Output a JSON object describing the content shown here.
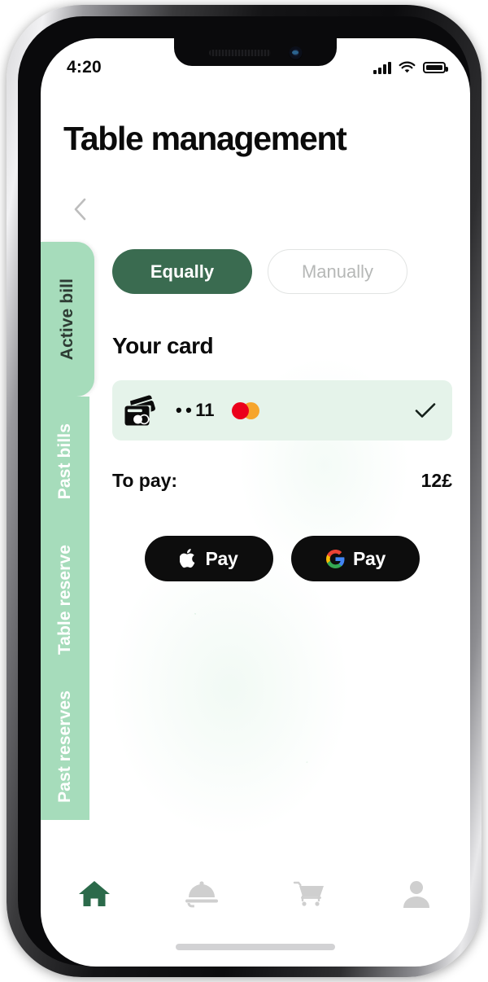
{
  "status_bar": {
    "time": "4:20",
    "signal_icon": "cellular-signal-icon",
    "wifi_icon": "wifi-icon",
    "battery_icon": "battery-full-icon"
  },
  "header": {
    "title": "Table management",
    "back_icon": "chevron-left-icon"
  },
  "side_tabs": [
    {
      "label": "Active bill",
      "active": true
    },
    {
      "label": "Past bills",
      "active": false
    },
    {
      "label": "Table reserve",
      "active": false
    },
    {
      "label": "Past reserves",
      "active": false
    }
  ],
  "split_toggle": {
    "equally_label": "Equally",
    "manually_label": "Manually",
    "selected": "Equally"
  },
  "card_section": {
    "heading": "Your card",
    "card_icon": "credit-card-swipe-icon",
    "digits": "• • 11",
    "brand_icon": "mastercard-logo",
    "selected_icon": "check-icon"
  },
  "to_pay": {
    "label": "To pay:",
    "amount": "12£"
  },
  "pay_buttons": [
    {
      "label": "Pay",
      "icon": "apple-logo-icon"
    },
    {
      "label": "Pay",
      "icon": "google-g-icon"
    }
  ],
  "bottom_nav": [
    {
      "icon": "home-icon",
      "active": true
    },
    {
      "icon": "room-service-icon",
      "active": false
    },
    {
      "icon": "shopping-cart-icon",
      "active": false
    },
    {
      "icon": "user-profile-icon",
      "active": false
    }
  ],
  "colors": {
    "brand_green": "#3A6B50",
    "sidebar_green": "#A6DCBB",
    "card_bg": "#E5F3EA",
    "pay_button_black": "#0D0D0D",
    "nav_inactive": "#CFCFCF"
  }
}
